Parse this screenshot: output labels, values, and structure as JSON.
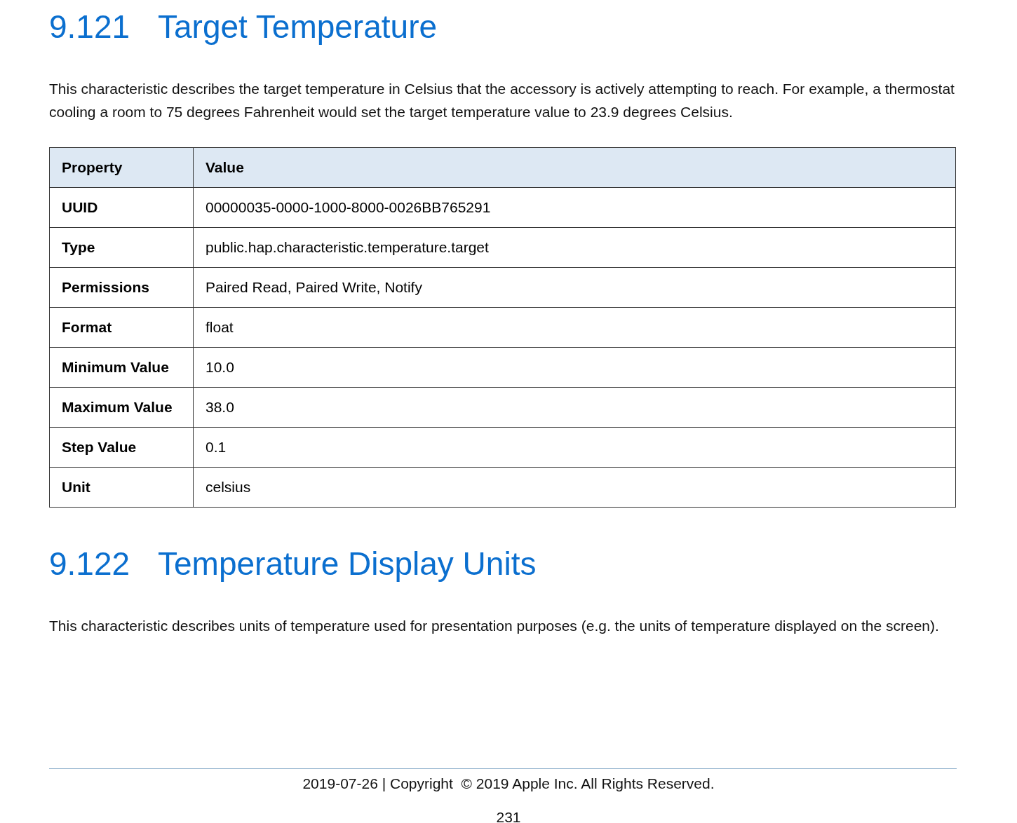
{
  "sections": [
    {
      "number": "9.121",
      "title": "Target Temperature",
      "paragraph": "This characteristic describes the target temperature in Celsius that the accessory is actively attempting to reach.  For example, a thermostat cooling a room to 75 degrees Fahrenheit would set the target temperature value to 23.9 degrees Celsius.",
      "table": {
        "columns": [
          "Property",
          "Value"
        ],
        "rows": [
          [
            "UUID",
            "00000035-0000-1000-8000-0026BB765291"
          ],
          [
            "Type",
            "public.hap.characteristic.temperature.target"
          ],
          [
            "Permissions",
            "Paired Read, Paired Write, Notify"
          ],
          [
            "Format",
            "float"
          ],
          [
            "Minimum Value",
            "10.0"
          ],
          [
            "Maximum Value",
            "38.0"
          ],
          [
            "Step Value",
            "0.1"
          ],
          [
            "Unit",
            "celsius"
          ]
        ]
      }
    },
    {
      "number": "9.122",
      "title": "Temperature Display Units",
      "paragraph": "This characteristic describes units of temperature used for presentation purposes (e.g.  the units of temperature displayed on the screen)."
    }
  ],
  "footer": {
    "text": "2019-07-26 | Copyright  © 2019 Apple Inc. All Rights Reserved.",
    "page_number": "231"
  }
}
